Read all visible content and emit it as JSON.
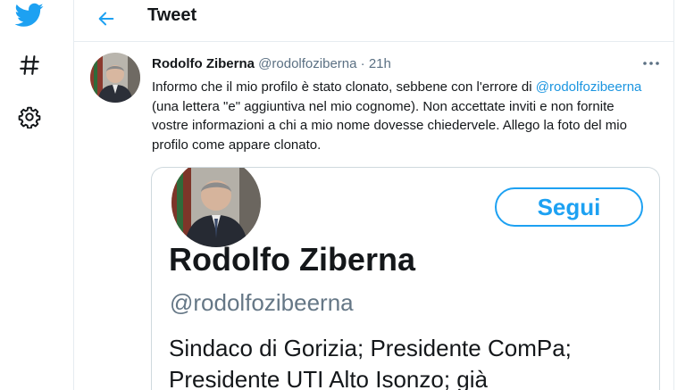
{
  "colors": {
    "accent": "#1da1f2",
    "mention": "#1b95e0",
    "muted": "#5b7083",
    "border": "#e6ecf0"
  },
  "nav": {
    "items": [
      {
        "icon": "twitter-logo-icon"
      },
      {
        "icon": "hashtag-icon"
      },
      {
        "icon": "gear-icon"
      }
    ]
  },
  "header": {
    "back_icon": "arrow-left-icon",
    "title": "Tweet"
  },
  "tweet": {
    "display_name": "Rodolfo Ziberna",
    "handle": "@rodolfoziberna",
    "separator": " · ",
    "time": "21h",
    "more_icon": "more-icon",
    "text_part1": "Informo che il mio profilo è stato clonato, sebbene con l'errore di ",
    "mention": "@rodolfozibeerna",
    "text_part2": " (una lettera \"e\" aggiuntiva nel mio cognome). Non accettate inviti e non fornite vostre informazioni a chi a mio nome dovesse chiedervele. Allego la foto del mio profilo come appare clonato."
  },
  "card": {
    "follow_label": "Segui",
    "name": "Rodolfo Ziberna",
    "handle": "@rodolfozibeerna",
    "bio_line1": "Sindaco di Gorizia; Presidente ComPa;",
    "bio_line2": "Presidente UTI Alto Isonzo; già"
  }
}
